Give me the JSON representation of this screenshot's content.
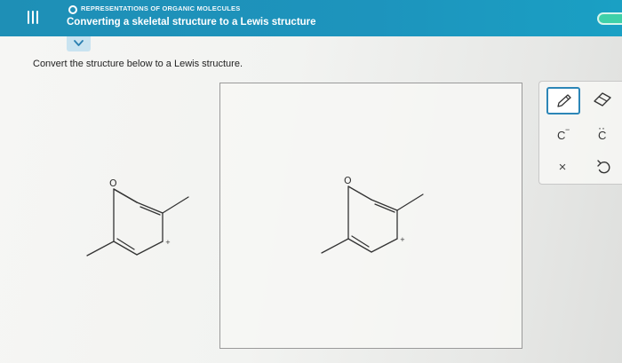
{
  "header": {
    "topic": "REPRESENTATIONS OF ORGANIC MOLECULES",
    "title": "Converting a skeletal structure to a Lewis structure"
  },
  "instruction": "Convert the structure below to a Lewis structure.",
  "molecule": {
    "oxygen_label": "O",
    "charge_label": "+"
  },
  "toolbar": {
    "carbanion_symbol": "C",
    "carbanion_charge": "−",
    "lone_pair_symbol": "C",
    "lone_pair_dots": "··",
    "clear_symbol": "×"
  },
  "colors": {
    "header": "#1e8fb6",
    "progress": "#3fd1a8",
    "tool_border": "#2c86b7"
  }
}
